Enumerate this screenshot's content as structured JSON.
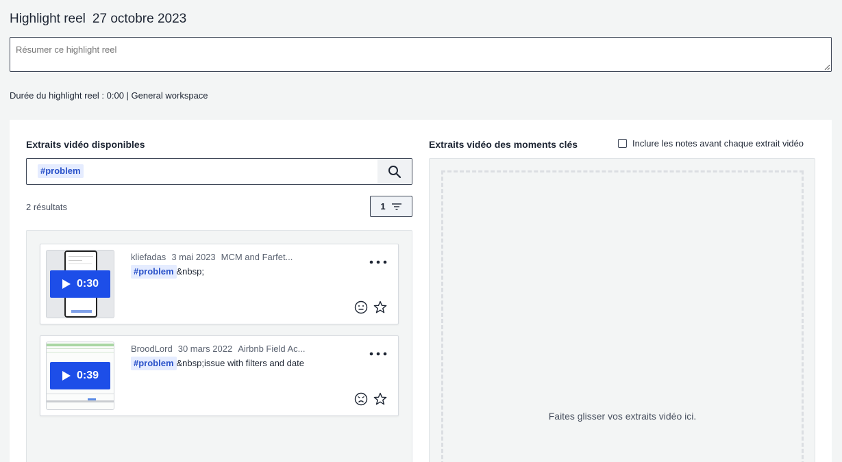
{
  "header": {
    "title": "Highlight reel",
    "date": "27 octobre 2023"
  },
  "summary": {
    "placeholder": "Résumer ce highlight reel"
  },
  "meta_line": "Durée du highlight reel : 0:00 | General workspace",
  "available": {
    "heading": "Extraits vidéo disponibles",
    "search_tag": "#problem",
    "results": "2 résultats",
    "filter_count": "1",
    "clips": [
      {
        "duration": "0:30",
        "author": "kliefadas",
        "date": "3 mai 2023",
        "project": "MCM and Farfet...",
        "tag": "#problem",
        "text": "&nbsp;",
        "sentiment": "neutral-face-icon"
      },
      {
        "duration": "0:39",
        "author": "BroodLord",
        "date": "30 mars 2022",
        "project": "Airbnb Field Ac...",
        "tag": "#problem",
        "text": "&nbsp;issue with filters and date",
        "sentiment": "sad-face-icon"
      }
    ]
  },
  "key_moments": {
    "heading": "Extraits vidéo des moments clés",
    "include_notes_label": "Inclure les notes avant chaque extrait vidéo",
    "drop_text": "Faites glisser vos extraits vidéo ici."
  },
  "colors": {
    "accent": "#1d4ee8",
    "tag_bg": "#e5ecff",
    "tag_text": "#2a52c9"
  }
}
